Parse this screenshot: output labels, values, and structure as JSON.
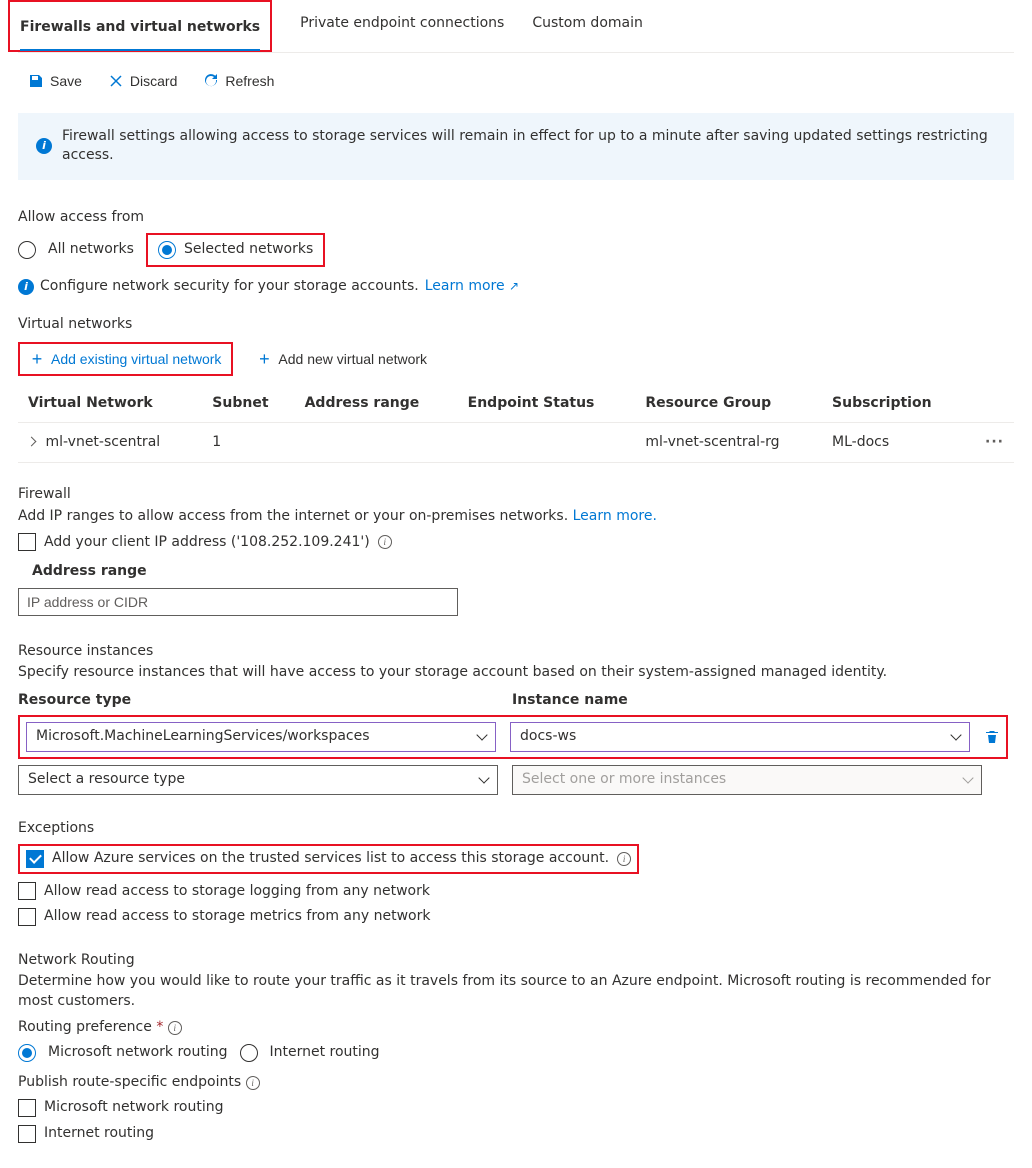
{
  "tabs": {
    "firewalls": "Firewalls and virtual networks",
    "private": "Private endpoint connections",
    "custom": "Custom domain"
  },
  "toolbar": {
    "save": "Save",
    "discard": "Discard",
    "refresh": "Refresh"
  },
  "banner": "Firewall settings allowing access to storage services will remain in effect for up to a minute after saving updated settings restricting access.",
  "access": {
    "label": "Allow access from",
    "all": "All networks",
    "selected": "Selected networks",
    "config_text": "Configure network security for your storage accounts.",
    "learn_more": "Learn more"
  },
  "vnet": {
    "title": "Virtual networks",
    "add_existing": "Add existing virtual network",
    "add_new": "Add new virtual network",
    "cols": {
      "vn": "Virtual Network",
      "subnet": "Subnet",
      "range": "Address range",
      "endpoint": "Endpoint Status",
      "rg": "Resource Group",
      "sub": "Subscription"
    },
    "row": {
      "vn": "ml-vnet-scentral",
      "subnet": "1",
      "range": "",
      "endpoint": "",
      "rg": "ml-vnet-scentral-rg",
      "sub": "ML-docs"
    }
  },
  "firewall": {
    "title": "Firewall",
    "desc": "Add IP ranges to allow access from the internet or your on-premises networks.",
    "learn_more": "Learn more.",
    "client_ip": "Add your client IP address ('108.252.109.241')",
    "range_label": "Address range",
    "range_placeholder": "IP address or CIDR"
  },
  "resource": {
    "title": "Resource instances",
    "desc": "Specify resource instances that will have access to your storage account based on their system-assigned managed identity.",
    "col_type": "Resource type",
    "col_inst": "Instance name",
    "type_value": "Microsoft.MachineLearningServices/workspaces",
    "inst_value": "docs-ws",
    "type_placeholder": "Select a resource type",
    "inst_placeholder": "Select one or more instances"
  },
  "exceptions": {
    "title": "Exceptions",
    "trusted": "Allow Azure services on the trusted services list to access this storage account.",
    "logging": "Allow read access to storage logging from any network",
    "metrics": "Allow read access to storage metrics from any network"
  },
  "routing": {
    "title": "Network Routing",
    "desc": "Determine how you would like to route your traffic as it travels from its source to an Azure endpoint. Microsoft routing is recommended for most customers.",
    "pref_label": "Routing preference",
    "ms_routing": "Microsoft network routing",
    "int_routing": "Internet routing",
    "publish_label": "Publish route-specific endpoints",
    "pub_ms": "Microsoft network routing",
    "pub_int": "Internet routing"
  }
}
